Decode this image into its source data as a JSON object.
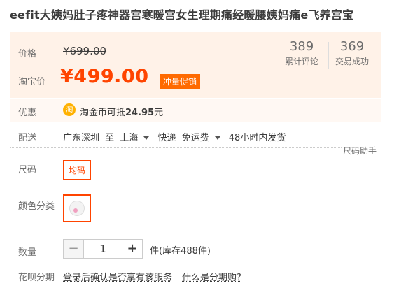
{
  "product": {
    "title": "eefit大姨妈肚子疼神器宫寒暖宫女生理期痛经暖腰姨妈痛e飞养宫宝"
  },
  "price": {
    "label": "价格",
    "original": "¥699.00",
    "tb_label": "淘宝价",
    "current": "¥499.00",
    "promo_tag": "冲量促销"
  },
  "stats": {
    "reviews_count": "389",
    "reviews_label": "累计评论",
    "trades_count": "369",
    "trades_label": "交易成功"
  },
  "coupon": {
    "label": "优惠",
    "icon_text": "淘",
    "text_prefix": "淘金币可抵",
    "amount": "24.95",
    "unit": "元"
  },
  "shipping": {
    "label": "配送",
    "from": "广东深圳",
    "to_word": "至",
    "destination": "上海",
    "method": "快递",
    "fee": "免运费",
    "dispatch": "48小时内发货"
  },
  "size": {
    "helper": "尺码助手",
    "label": "尺码",
    "option": "均码"
  },
  "color": {
    "label": "颜色分类"
  },
  "quantity": {
    "label": "数量",
    "minus": "−",
    "value": "1",
    "plus": "+",
    "stock": "件(库存488件)"
  },
  "installment": {
    "label": "花呗分期",
    "text": "登录后确认是否享有该服务",
    "link": "什么是分期购?"
  },
  "colors": {
    "accent": "#ff4400",
    "promo": "#ff6a00",
    "panel_bg": "#fff2e8"
  }
}
